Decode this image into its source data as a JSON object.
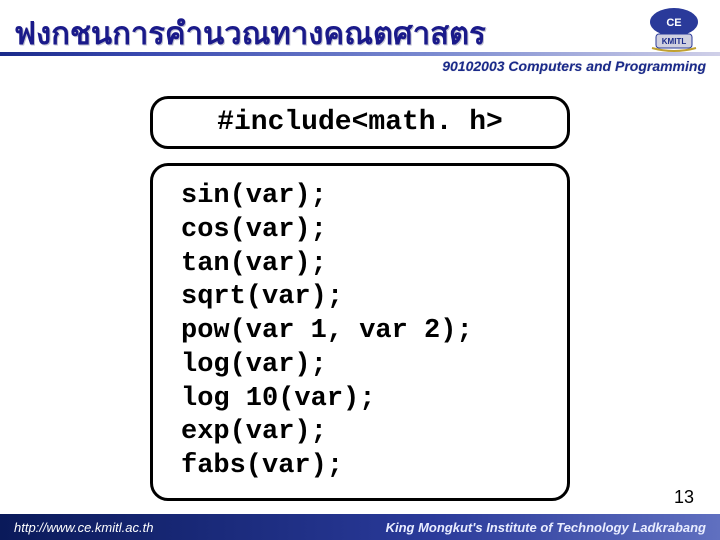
{
  "header": {
    "title": "ฟงกชนการคำนวณทางคณตศาสตร",
    "course": "90102003 Computers and Programming",
    "logo_label": "CE KMITL"
  },
  "content": {
    "include_line": "#include<math. h>",
    "functions": [
      "sin(var);",
      "cos(var);",
      "tan(var);",
      "sqrt(var);",
      "pow(var 1, var 2);",
      "log(var);",
      "log 10(var);",
      "exp(var);",
      "fabs(var);"
    ]
  },
  "page_number": "13",
  "footer": {
    "url": "http://www.ce.kmitl.ac.th",
    "institution": "King Mongkut's Institute of Technology Ladkrabang"
  },
  "colors": {
    "accent": "#1a2a8a",
    "footer_bg": "#1a2a8a"
  }
}
